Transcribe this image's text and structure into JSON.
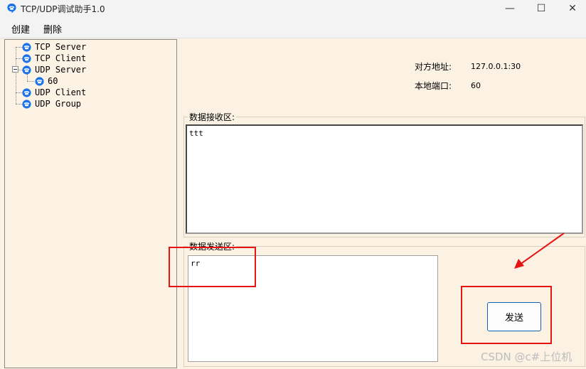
{
  "window": {
    "title": "TCP/UDP调试助手1.0",
    "minimize_glyph": "—",
    "maximize_glyph": "☐",
    "close_glyph": "✕"
  },
  "menu": {
    "create": "创建",
    "delete": "删除"
  },
  "tree": {
    "items": [
      {
        "label": "TCP Server"
      },
      {
        "label": "TCP Client"
      },
      {
        "label": "UDP Server"
      },
      {
        "label": "60"
      },
      {
        "label": "UDP Client"
      },
      {
        "label": "UDP Group"
      }
    ]
  },
  "connection": {
    "remote_label": "对方地址:",
    "remote_value": "127.0.0.1:30",
    "local_port_label": "本地端口:",
    "local_port_value": "60"
  },
  "receive": {
    "title": "数据接收区:",
    "content": "ttt"
  },
  "send": {
    "title": "数据发送区:",
    "content": "rr",
    "button_label": "发送"
  },
  "watermark": "CSDN @c#上位机",
  "colors": {
    "annotation_red": "#e81414",
    "button_border": "#0a64b4",
    "background": "#fbf2e3",
    "icon_blue": "#1a73e8"
  }
}
